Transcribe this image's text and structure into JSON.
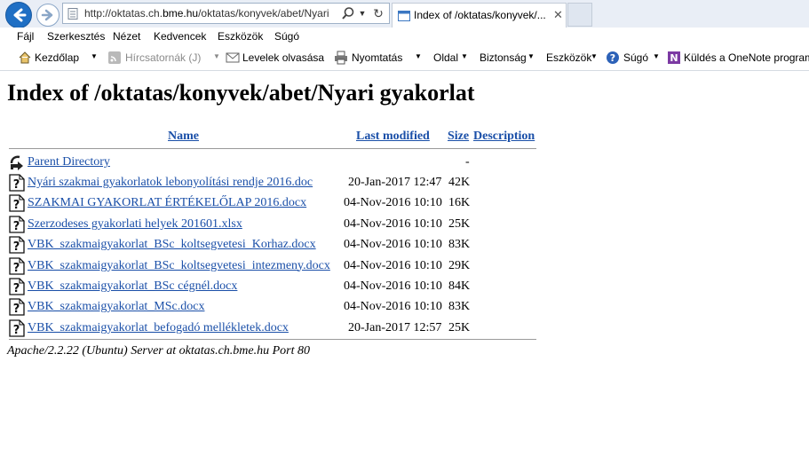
{
  "browser": {
    "address_url_prefix": "http://oktatas.ch.",
    "address_url_domain": "bme.hu",
    "address_url_suffix": "/oktatas/konyvek/abet/Nyari",
    "tab_title": "Index of /oktatas/konyvek/...",
    "tab_close": "✕"
  },
  "menubar": {
    "items": [
      "Fájl",
      "Szerkesztés",
      "Nézet",
      "Kedvencek",
      "Eszközök",
      "Súgó"
    ]
  },
  "commandbar": {
    "home": "Kezdőlap",
    "feeds": "Hírcsatornák (J)",
    "mail": "Levelek olvasása",
    "print": "Nyomtatás",
    "page": "Oldal",
    "safety": "Biztonság",
    "tools": "Eszközök",
    "help": "Súgó",
    "onenote": "Küldés a OneNote programba"
  },
  "page": {
    "title": "Index of /oktatas/konyvek/abet/Nyari gyakorlat",
    "headers": {
      "name": "Name",
      "last_modified": "Last modified",
      "size": "Size",
      "description": "Description"
    },
    "parent": {
      "name": "Parent Directory",
      "size": "-"
    },
    "files": [
      {
        "name": "Nyári szakmai gyakorlatok lebonyolítási rendje 2016.doc",
        "modified": "20-Jan-2017 12:47",
        "size": "42K"
      },
      {
        "name": "SZAKMAI GYAKORLAT ÉRTÉKELŐLAP 2016.docx",
        "modified": "04-Nov-2016 10:10",
        "size": "16K"
      },
      {
        "name": "Szerzodeses gyakorlati helyek 201601.xlsx",
        "modified": "04-Nov-2016 10:10",
        "size": "25K"
      },
      {
        "name": "VBK_szakmaigyakorlat_BSc_koltsegvetesi_Korhaz.docx",
        "modified": "04-Nov-2016 10:10",
        "size": "83K"
      },
      {
        "name": "VBK_szakmaigyakorlat_BSc_koltsegvetesi_intezmeny.docx",
        "modified": "04-Nov-2016 10:10",
        "size": "29K"
      },
      {
        "name": "VBK_szakmaigyakorlat_BSc cégnél.docx",
        "modified": "04-Nov-2016 10:10",
        "size": "84K"
      },
      {
        "name": "VBK_szakmaigyakorlat_MSc.docx",
        "modified": "04-Nov-2016 10:10",
        "size": "83K"
      },
      {
        "name": "VBK_szakmaigyakorlat_befogadó mellékletek.docx",
        "modified": "20-Jan-2017 12:57",
        "size": "25K"
      }
    ],
    "server_signature": "Apache/2.2.22 (Ubuntu) Server at oktatas.ch.bme.hu Port 80"
  }
}
